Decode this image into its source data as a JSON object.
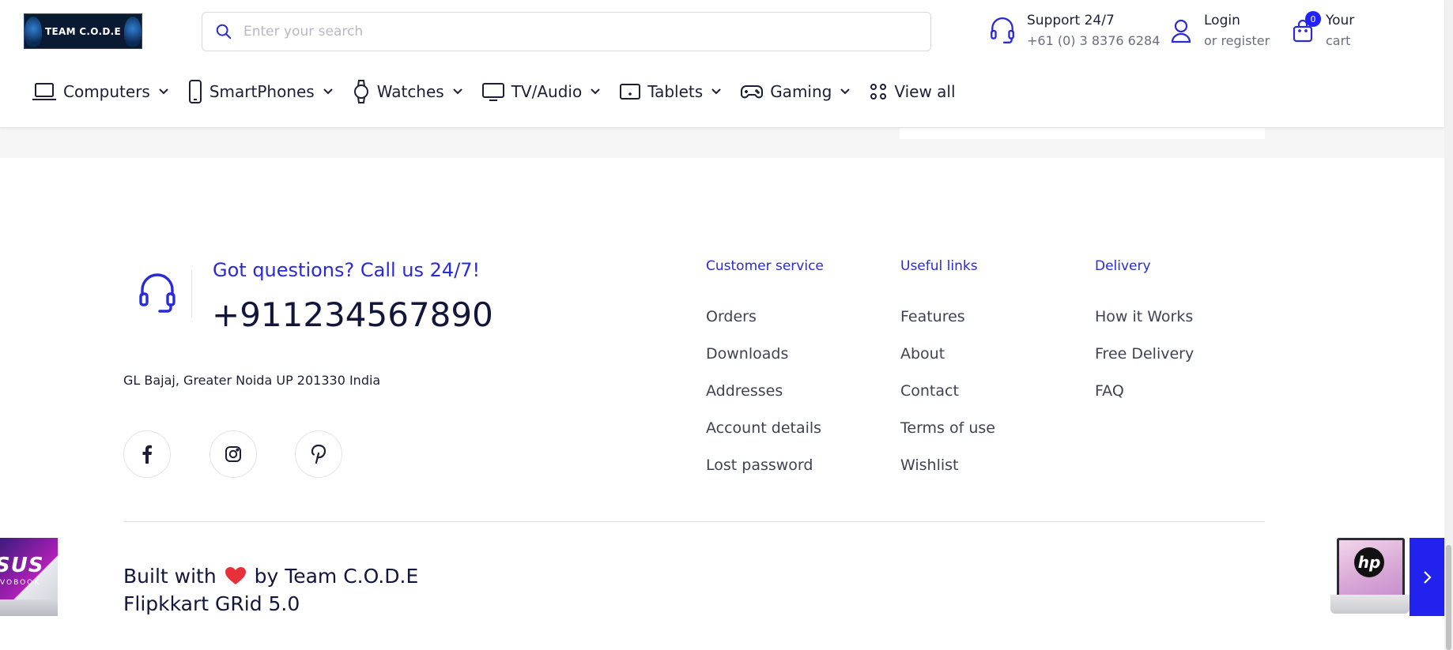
{
  "header": {
    "logo_text": "TEAM C.O.D.E",
    "search_placeholder": "Enter your search",
    "support": {
      "title": "Support 24/7",
      "phone": "+61 (0) 3 8376 6284"
    },
    "account": {
      "login": "Login",
      "register": "or register"
    },
    "cart": {
      "count": "0",
      "line1": "Your",
      "line2": "cart"
    }
  },
  "nav": {
    "items": [
      {
        "label": "Computers",
        "icon": "laptop-icon"
      },
      {
        "label": "SmartPhones",
        "icon": "smartphone-icon"
      },
      {
        "label": "Watches",
        "icon": "watch-icon"
      },
      {
        "label": "TV/Audio",
        "icon": "tv-icon"
      },
      {
        "label": "Tablets",
        "icon": "tablet-icon"
      },
      {
        "label": "Gaming",
        "icon": "gamepad-icon"
      }
    ],
    "view_all": "View all"
  },
  "footer": {
    "call_title": "Got questions? Call us 24/7!",
    "call_phone": "+911234567890",
    "address": "GL Bajaj, Greater Noida UP 201330 India",
    "social": [
      "facebook-icon",
      "instagram-icon",
      "pinterest-icon"
    ],
    "columns": [
      {
        "title": "Customer service",
        "links": [
          "Orders",
          "Downloads",
          "Addresses",
          "Account details",
          "Lost password"
        ]
      },
      {
        "title": "Useful links",
        "links": [
          "Features",
          "About",
          "Contact",
          "Terms of use",
          "Wishlist"
        ]
      },
      {
        "title": "Delivery",
        "links": [
          "How it Works",
          "Free Delivery",
          "FAQ"
        ]
      }
    ],
    "credit_prefix": "Built with",
    "credit_suffix": "by Team C.O.D.E",
    "credit_line2": "Flipkkart GRid 5.0"
  },
  "thumbs": {
    "left_brand": "SUS",
    "left_sub": "VOBOOK",
    "right_brand": "hp"
  },
  "colors": {
    "accent": "#2222ee",
    "link_title": "#2a2ad6",
    "text_dark": "#12163a",
    "heart": "#e8303a"
  }
}
